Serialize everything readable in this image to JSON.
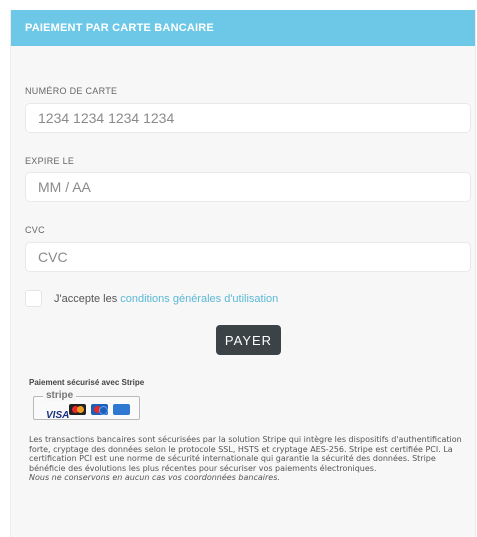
{
  "header": {
    "title": "PAIEMENT PAR CARTE BANCAIRE"
  },
  "card_number": {
    "label": "NUMÉRO DE CARTE",
    "placeholder": "1234 1234 1234 1234"
  },
  "expiry": {
    "label": "EXPIRE LE",
    "placeholder": "MM / AA"
  },
  "cvc": {
    "label": "CVC",
    "placeholder": "CVC"
  },
  "terms": {
    "prefix": "J'accepte les",
    "link": "conditions générales d'utilisation"
  },
  "pay_button": {
    "label": "PAYER"
  },
  "stripe": {
    "title": "Paiement sécurisé avec Stripe",
    "badge_word": "stripe",
    "visa_text": "VISA",
    "logos": [
      "visa-logo",
      "mastercard-logo",
      "maestro-logo",
      "amex-logo"
    ]
  },
  "disclaimer": {
    "text": "Les transactions bancaires sont sécurisées par la solution Stripe qui intègre les dispositifs d'authentification forte, cryptage des données selon le protocole SSL, HSTS et cryptage AES-256. Stripe est certifiée PCI. La certification PCI est une norme de sécurité internationale qui garantie la sécurité des données. Stripe bénéficie des évolutions les plus récentes pour sécuriser vos paiements électroniques.",
    "italic": "Nous ne conservons en aucun cas vos coordonnées bancaires."
  },
  "colors": {
    "header": "#6cc8e6",
    "button": "#3c4347",
    "link": "#5bb8d6"
  }
}
